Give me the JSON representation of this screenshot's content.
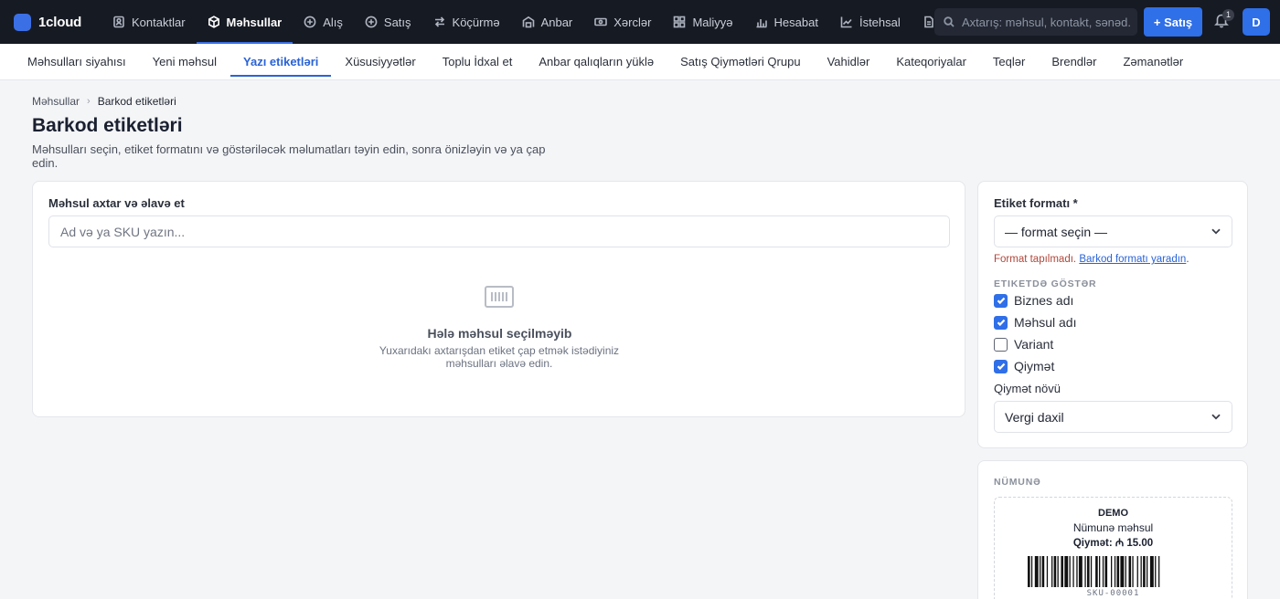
{
  "app": {
    "name": "1cloud"
  },
  "nav": {
    "items": [
      {
        "label": "Kontaktlar",
        "icon": "contacts-icon"
      },
      {
        "label": "Məhsullar",
        "icon": "box-icon",
        "active": true
      },
      {
        "label": "Alış",
        "icon": "plus-circle-icon"
      },
      {
        "label": "Satış",
        "icon": "plus-circle-icon"
      },
      {
        "label": "Köçürmə",
        "icon": "transfer-icon"
      },
      {
        "label": "Anbar",
        "icon": "warehouse-icon"
      },
      {
        "label": "Xərclər",
        "icon": "money-icon"
      },
      {
        "label": "Maliyyə",
        "icon": "grid-icon"
      },
      {
        "label": "Hesabat",
        "icon": "bar-chart-icon"
      },
      {
        "label": "İstehsal",
        "icon": "line-chart-icon"
      }
    ]
  },
  "search": {
    "placeholder": "Axtarış: məhsul, kontakt, sənəd..."
  },
  "header": {
    "new_sale_label": "+ Satış",
    "notification_count": "1",
    "avatar_initial": "D"
  },
  "subnav": {
    "items": [
      {
        "label": "Məhsulları siyahısı"
      },
      {
        "label": "Yeni məhsul"
      },
      {
        "label": "Yazı etiketləri",
        "active": true
      },
      {
        "label": "Xüsusiyyətlər"
      },
      {
        "label": "Toplu İdxal et"
      },
      {
        "label": "Anbar qalıqların yüklə"
      },
      {
        "label": "Satış Qiymətləri Qrupu"
      },
      {
        "label": "Vahidlər"
      },
      {
        "label": "Kateqoriyalar"
      },
      {
        "label": "Teqlər"
      },
      {
        "label": "Brendlər"
      },
      {
        "label": "Zəmanətlər"
      }
    ]
  },
  "breadcrumb": {
    "parent": "Məhsullar",
    "current": "Barkod etiketləri"
  },
  "page": {
    "title": "Barkod etiketləri",
    "subtitle": "Məhsulları seçin, etiket formatını və göstəriləcək məlumatları təyin edin, sonra önizləyin və ya çap edin."
  },
  "product_search": {
    "label": "Məhsul axtar və əlavə et",
    "placeholder": "Ad və ya SKU yazın...",
    "empty_title": "Hələ məhsul seçilməyib",
    "empty_desc": "Yuxarıdakı axtarışdan etiket çap etmək istədiyiniz məhsulları əlavə edin."
  },
  "settings": {
    "format_label": "Etiket formatı *",
    "format_value": "— format seçin —",
    "format_missing": "Format tapılmadı.",
    "format_create_link": "Barkod formatı yaradın",
    "format_note_end": ".",
    "show_label": "Etiketdə göstər",
    "options": [
      {
        "label": "Biznes adı",
        "checked": true
      },
      {
        "label": "Məhsul adı",
        "checked": true
      },
      {
        "label": "Variant",
        "checked": false
      },
      {
        "label": "Qiymət",
        "checked": true
      }
    ],
    "price_type_label": "Qiymət növü",
    "price_type_value": "Vergi daxil"
  },
  "sample": {
    "label": "Nümunə",
    "business": "DEMO",
    "product": "Nümunə məhsul",
    "price": "Qiymət: ₼ 15.00",
    "sku": "SKU-00001"
  },
  "colors": {
    "topbar": "#161a23",
    "accent": "#2f6fe8",
    "link": "#2a63d6",
    "error": "#b0463a"
  }
}
